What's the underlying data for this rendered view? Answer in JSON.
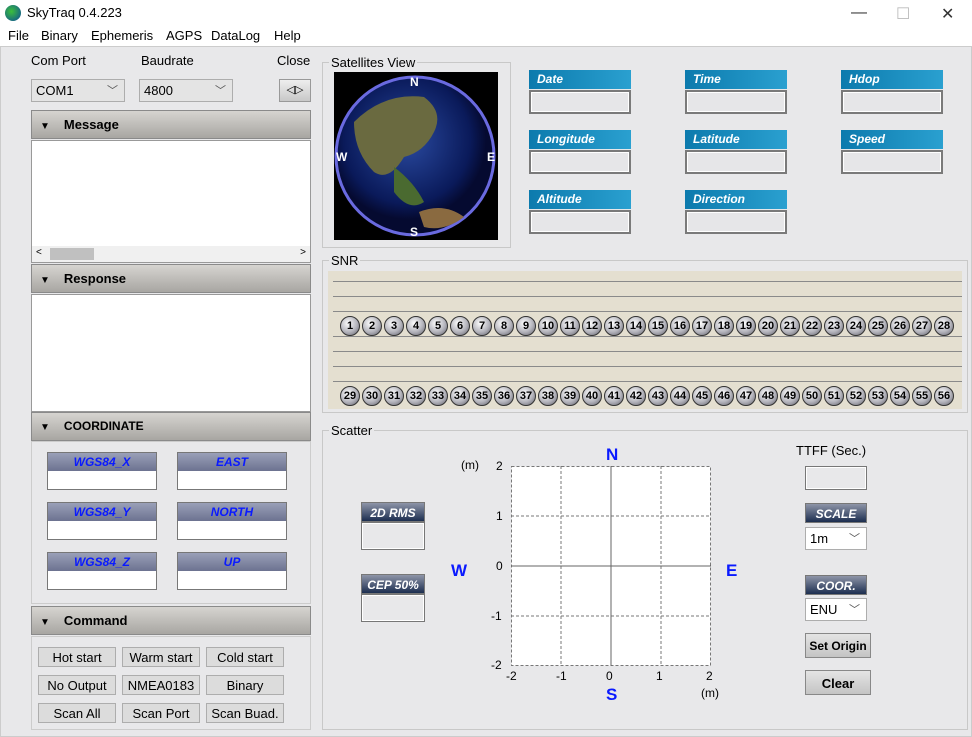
{
  "window": {
    "title": "SkyTraq 0.4.223",
    "minimize": "—",
    "maximize": "☐",
    "close": "✕"
  },
  "menu": [
    "File",
    "Binary",
    "Ephemeris",
    "AGPS",
    "DataLog",
    "Help"
  ],
  "connection": {
    "com_port_label": "Com Port",
    "com_port_value": "COM1",
    "baudrate_label": "Baudrate",
    "baudrate_value": "4800",
    "close_label": "Close"
  },
  "sections": {
    "message": "Message",
    "response": "Response",
    "coordinate": "COORDINATE",
    "command": "Command"
  },
  "coordinate_fields": [
    "WGS84_X",
    "EAST",
    "WGS84_Y",
    "NORTH",
    "WGS84_Z",
    "UP"
  ],
  "commands": [
    "Hot start",
    "Warm start",
    "Cold start",
    "No Output",
    "NMEA0183",
    "Binary",
    "Scan All",
    "Scan Port",
    "Scan Buad."
  ],
  "satellites_view": {
    "title": "Satellites View",
    "n": "N",
    "s": "S",
    "e": "E",
    "w": "W"
  },
  "info_fields": [
    "Date",
    "Time",
    "Hdop",
    "Longitude",
    "Latitude",
    "Speed",
    "Altitude",
    "Direction"
  ],
  "snr": {
    "title": "SNR",
    "satellite_ids": [
      1,
      2,
      3,
      4,
      5,
      6,
      7,
      8,
      9,
      10,
      11,
      12,
      13,
      14,
      15,
      16,
      17,
      18,
      19,
      20,
      21,
      22,
      23,
      24,
      25,
      26,
      27,
      28,
      29,
      30,
      31,
      32,
      33,
      34,
      35,
      36,
      37,
      38,
      39,
      40,
      41,
      42,
      43,
      44,
      45,
      46,
      47,
      48,
      49,
      50,
      51,
      52,
      53,
      54,
      55,
      56
    ]
  },
  "scatter": {
    "title": "Scatter",
    "rms_label": "2D RMS",
    "cep_label": "CEP 50%",
    "unit": "(m)",
    "y_ticks": [
      "2",
      "1",
      "0",
      "-1",
      "-2"
    ],
    "x_ticks": [
      "-2",
      "-1",
      "0",
      "1",
      "2"
    ],
    "n": "N",
    "s": "S",
    "e": "E",
    "w": "W",
    "ttff_label": "TTFF (Sec.)",
    "scale_label": "SCALE",
    "scale_value": "1m",
    "coor_label": "COOR.",
    "coor_value": "ENU",
    "set_origin": "Set Origin",
    "clear": "Clear"
  },
  "colors": {
    "compass": "#0a1aff",
    "info_header": "#1a8cc0",
    "snr_bg": "#e4dfd0"
  }
}
